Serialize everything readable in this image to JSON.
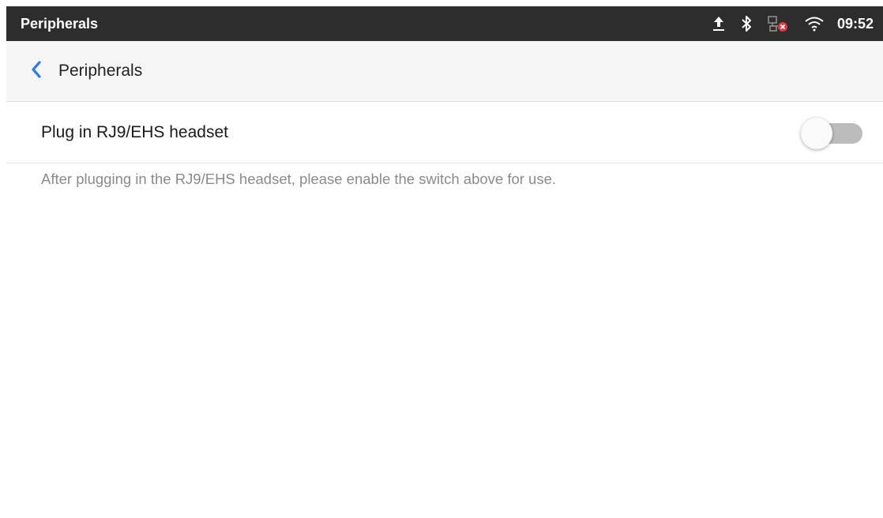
{
  "status_bar": {
    "title": "Peripherals",
    "time": "09:52",
    "icons": [
      "upload-icon",
      "bluetooth-icon",
      "network-disconnected-icon",
      "wifi-icon"
    ]
  },
  "app_bar": {
    "back_icon": "chevron-left-icon",
    "title": "Peripherals"
  },
  "settings": {
    "ehs_headset": {
      "label": "Plug in RJ9/EHS headset",
      "enabled": false
    },
    "hint": "After plugging in the RJ9/EHS headset, please enable the switch above for use."
  },
  "colors": {
    "status_bar_bg": "#2d2d2d",
    "app_bar_bg": "#f5f5f5",
    "accent": "#2f7de1",
    "toggle_track_off": "#bcbcbc",
    "hint_text": "#8a8a8a"
  }
}
